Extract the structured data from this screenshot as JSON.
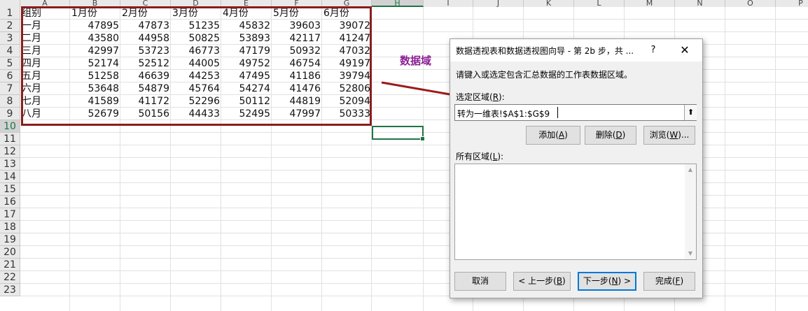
{
  "spreadsheet": {
    "columns": [
      "A",
      "B",
      "C",
      "D",
      "E",
      "F",
      "G",
      "H",
      "I",
      "J",
      "K",
      "L",
      "M",
      "N",
      "O",
      "P"
    ],
    "active_column": "H",
    "rows": [
      "1",
      "2",
      "3",
      "4",
      "5",
      "6",
      "7",
      "8",
      "9",
      "10",
      "11",
      "12",
      "13",
      "14",
      "15",
      "16",
      "17",
      "18",
      "19",
      "20",
      "21",
      "22",
      "23"
    ],
    "active_row": "10",
    "table": [
      [
        "组别",
        "1月份",
        "2月份",
        "3月份",
        "4月份",
        "5月份",
        "6月份"
      ],
      [
        "一月",
        "47895",
        "47873",
        "51235",
        "45832",
        "39603",
        "39072"
      ],
      [
        "二月",
        "43580",
        "44958",
        "50825",
        "53893",
        "42117",
        "41247"
      ],
      [
        "三月",
        "42997",
        "53723",
        "46773",
        "47179",
        "50932",
        "47032"
      ],
      [
        "四月",
        "52174",
        "52512",
        "44005",
        "49752",
        "46754",
        "49197"
      ],
      [
        "五月",
        "51258",
        "46639",
        "44253",
        "47495",
        "41186",
        "39794"
      ],
      [
        "六月",
        "53648",
        "54879",
        "45764",
        "54274",
        "41476",
        "52806"
      ],
      [
        "七月",
        "41589",
        "41172",
        "52296",
        "50112",
        "44819",
        "52094"
      ],
      [
        "八月",
        "52679",
        "50156",
        "44433",
        "52495",
        "47997",
        "50333"
      ]
    ],
    "annotation": "数据域",
    "colors": {
      "range_border": "#8b1c1c",
      "active_green": "#217346",
      "annotation": "#8b2296",
      "arrow": "#9b1b1b"
    }
  },
  "dialog": {
    "title": "数据透视表和数据透视图向导 - 第 2b 步，共 ...",
    "help_label": "?",
    "close_label": "✕",
    "instruction": "请键入或选定包含汇总数据的工作表数据区域。",
    "range_label": "选定区域(",
    "range_label_key": "R",
    "range_label_end": "):",
    "range_value": "转为一维表!$A$1:$G$9",
    "add_label": "添加(",
    "add_key": "A",
    "delete_label": "删除(",
    "delete_key": "D",
    "browse_label": "浏览(",
    "browse_key": "W",
    "browse_end": ")...",
    "btn_end": ")",
    "all_ranges_label": "所有区域(",
    "all_ranges_key": "L",
    "cancel_label": "取消",
    "back_label": "< 上一步(",
    "back_key": "B",
    "next_label": "下一步(",
    "next_key": "N",
    "next_end": ") >",
    "finish_label": "完成(",
    "finish_key": "F",
    "collapse_icon": "⬆"
  }
}
